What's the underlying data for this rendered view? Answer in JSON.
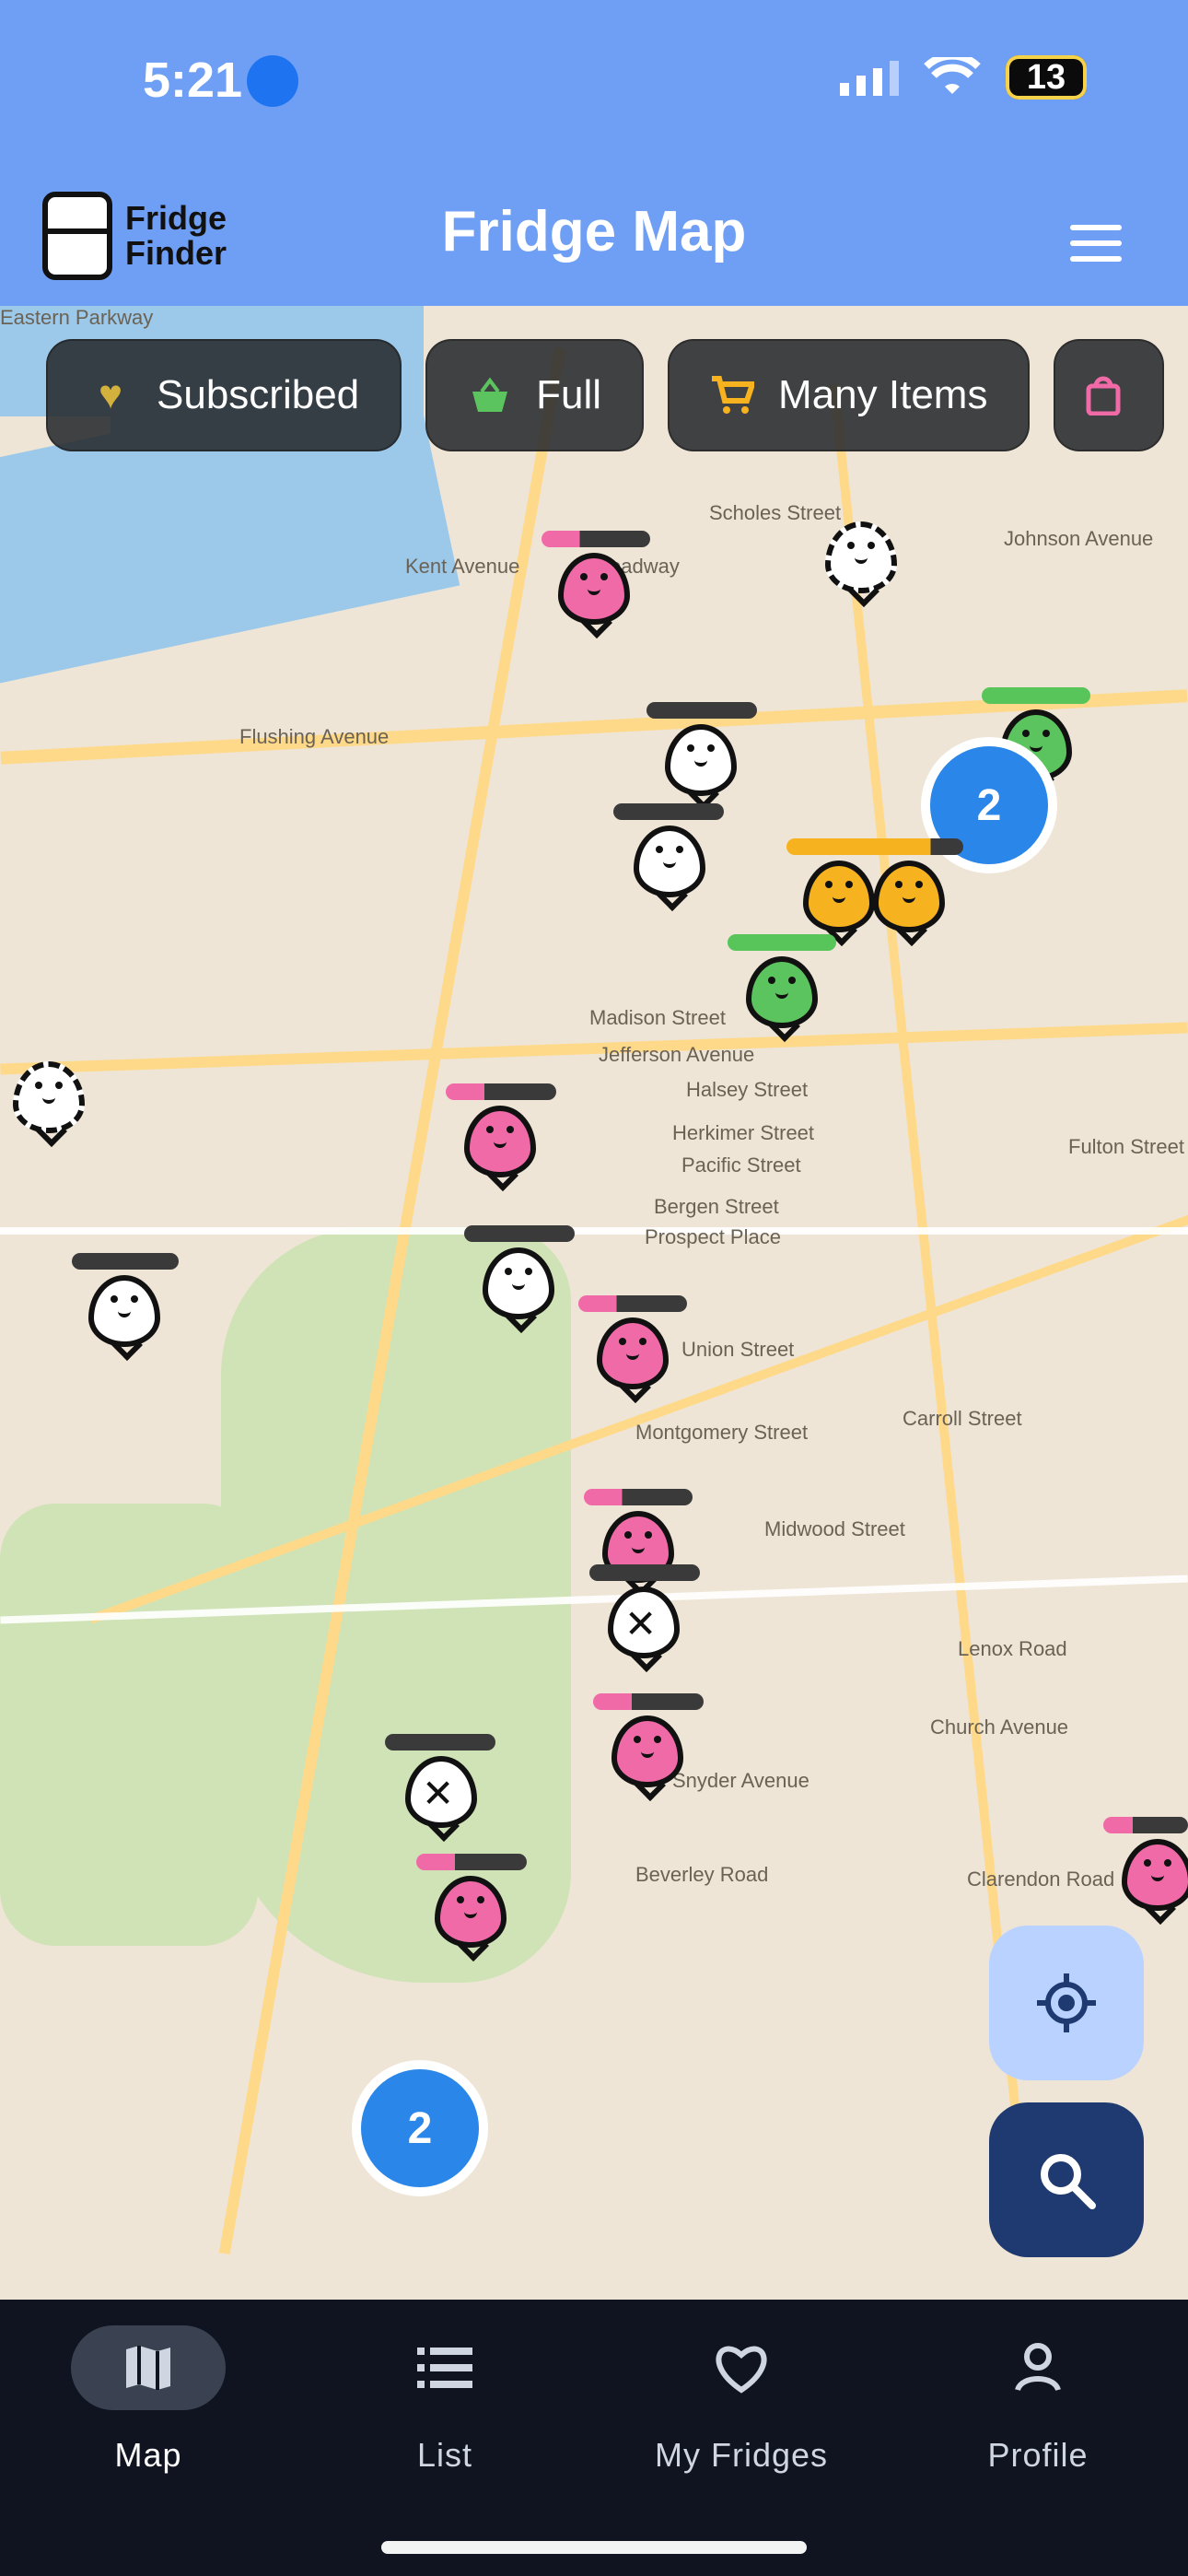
{
  "status_bar": {
    "time": "5:21",
    "battery": "13"
  },
  "header": {
    "brand_line1": "Fridge",
    "brand_line2": "Finder",
    "title": "Fridge Map"
  },
  "filters": [
    {
      "label": "Subscribed"
    },
    {
      "label": "Full"
    },
    {
      "label": "Many Items"
    }
  ],
  "map": {
    "clusters": [
      "2",
      "2"
    ],
    "labels": [
      "Scholes Street",
      "Johnson Avenue",
      "Flushing Avenue",
      "Kent Avenue",
      "Broadway",
      "Madison Street",
      "Jefferson Avenue",
      "Halsey Street",
      "Herkimer Street",
      "Pacific Street",
      "Bergen Street",
      "Prospect Place",
      "Carroll Street",
      "Montgomery Street",
      "Midwood Street",
      "Lenox Road",
      "Church Avenue",
      "Snyder Avenue",
      "Clarendon Road",
      "Beverley Road",
      "Fulton Street",
      "Union Street",
      "Eastern Parkway"
    ]
  },
  "nav": [
    {
      "label": "Map"
    },
    {
      "label": "List"
    },
    {
      "label": "My Fridges"
    },
    {
      "label": "Profile"
    }
  ],
  "colors": {
    "header": "#6f9ff4",
    "accent": "#2a86e8",
    "nav_bg": "#0f1420"
  }
}
